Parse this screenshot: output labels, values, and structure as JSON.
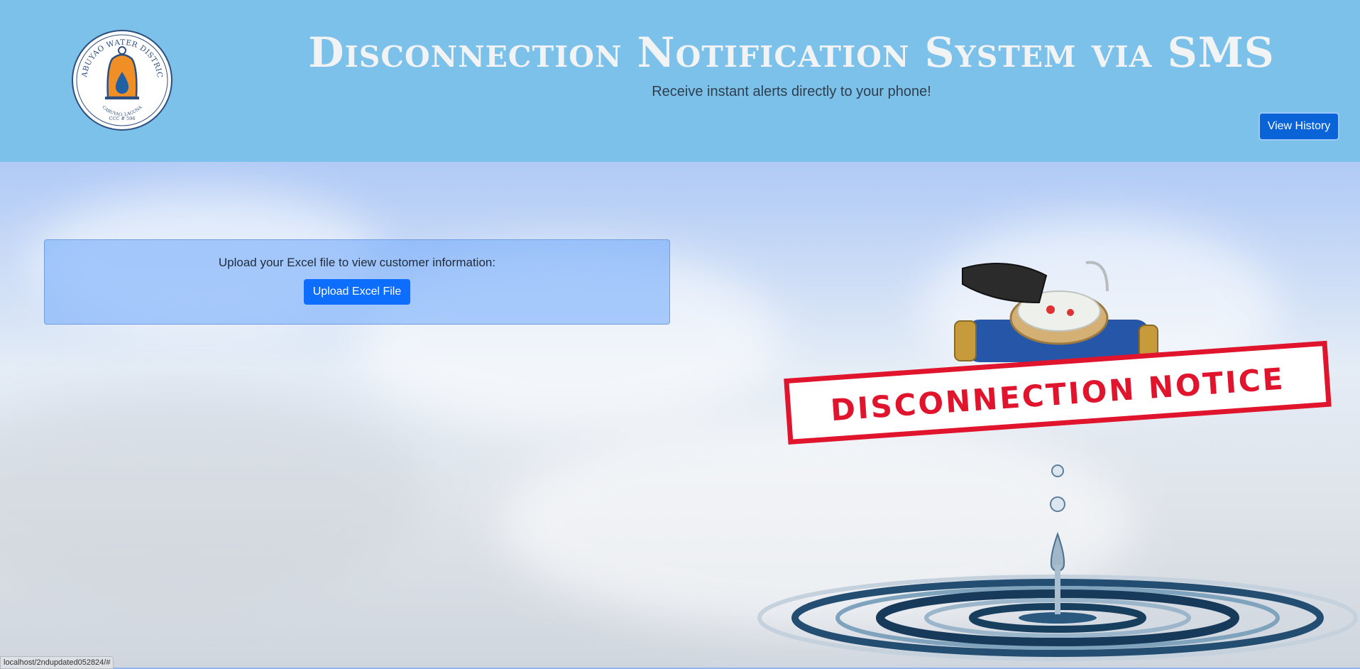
{
  "header": {
    "logo": {
      "name_text": "CABUYAO WATER DISTRICT",
      "location_text": "CABUYAO, LAGUNA",
      "ccc_text": "CCC # 596"
    },
    "title": "Disconnection Notification System via SMS",
    "subtitle": "Receive instant alerts directly to your phone!",
    "view_history_label": "View History"
  },
  "upload": {
    "prompt": "Upload your Excel file to view customer information:",
    "button_label": "Upload Excel File"
  },
  "illustration": {
    "stamp_text": "DISCONNECTION NOTICE",
    "stamp_color": "#e0142c",
    "icon": "water-meter-with-dripping-water"
  },
  "status_bar": {
    "url": "localhost/2ndupdated052824/#"
  },
  "colors": {
    "header_bg": "#7bc1ea",
    "primary_button": "#0d6efd"
  }
}
